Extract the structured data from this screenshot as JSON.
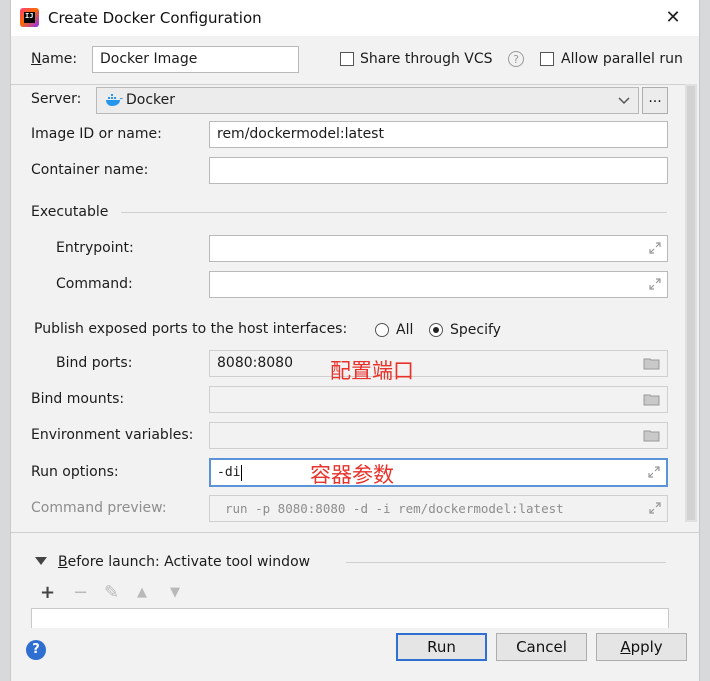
{
  "window": {
    "title": "Create Docker Configuration"
  },
  "name_row": {
    "label": "Name:",
    "value": "Docker Image",
    "share_label": "Share through VCS",
    "share_checked": false,
    "parallel_label": "Allow parallel run",
    "parallel_checked": false
  },
  "server": {
    "label": "Server:",
    "value": "Docker",
    "more_label": "..."
  },
  "image": {
    "label": "Image ID or name:",
    "value": "rem/dockermodel:latest"
  },
  "container": {
    "label": "Container name:",
    "value": ""
  },
  "executable": {
    "section_label": "Executable",
    "entrypoint_label": "Entrypoint:",
    "entrypoint_value": "",
    "command_label": "Command:",
    "command_value": ""
  },
  "ports": {
    "publish_label": "Publish exposed ports to the host interfaces:",
    "all_label": "All",
    "specify_label": "Specify",
    "selected": "Specify",
    "bind_label": "Bind ports:",
    "bind_value": "8080:8080",
    "bind_annotation": "配置端口"
  },
  "mounts": {
    "label": "Bind mounts:",
    "value": ""
  },
  "env": {
    "label": "Environment variables:",
    "value": ""
  },
  "run_options": {
    "label": "Run options:",
    "value": "-di",
    "annotation": "容器参数"
  },
  "preview": {
    "label": "Command preview:",
    "value": "run -p 8080:8080 -d -i rem/dockermodel:latest"
  },
  "before_launch": {
    "label": "Before launch: Activate tool window"
  },
  "toolbar": {
    "add": "+",
    "remove": "−",
    "edit": "✎",
    "up": "▲",
    "down": "▼"
  },
  "buttons": {
    "run": "Run",
    "cancel": "Cancel",
    "apply": "Apply",
    "help": "?"
  },
  "colors": {
    "accent": "#2f6fd1",
    "annotation": "#e8322a",
    "focus_border": "#5a93d8",
    "docker_blue": "#2496ed"
  }
}
